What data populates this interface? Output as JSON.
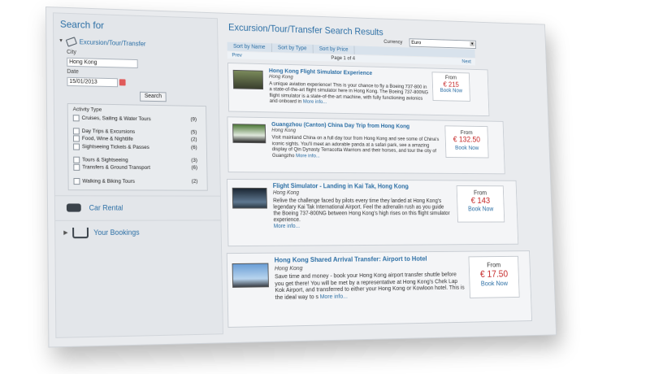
{
  "sidebar": {
    "title": "Search for",
    "tab_label": "Excursion/Tour/Transfer",
    "city_label": "City",
    "city_value": "Hong Kong",
    "date_label": "Date",
    "date_value": "15/01/2013",
    "search_button": "Search",
    "activity_title": "Activity Type",
    "activities": [
      {
        "label": "Cruises, Sailing & Water Tours",
        "count": "(9)"
      },
      {
        "label": "Day Trips & Excursions",
        "count": "(5)"
      },
      {
        "label": "Food, Wine & Nightlife",
        "count": "(2)"
      },
      {
        "label": "Sightseeing Tickets & Passes",
        "count": "(6)"
      },
      {
        "label": "Tours & Sightseeing",
        "count": "(3)"
      },
      {
        "label": "Transfers & Ground Transport",
        "count": "(6)"
      },
      {
        "label": "Walking & Biking Tours",
        "count": "(2)"
      }
    ],
    "car_rental": "Car Rental",
    "your_bookings": "Your Bookings"
  },
  "results": {
    "title": "Excursion/Tour/Transfer Search Results",
    "currency_label": "Currency",
    "currency_value": "Euro",
    "sort": [
      "Sort by Name",
      "Sort by Type",
      "Sort by Price"
    ],
    "pager": {
      "prev": "Prev",
      "page": "Page 1 of 4",
      "next": "Next"
    },
    "items": [
      {
        "title": "Hong Kong Flight Simulator Experience",
        "city": "Hong Kong",
        "desc": "A unique aviation experience! This is your chance to fly a Boeing 737-800 in a state-of-the-art flight simulator here in Hong Kong. The Boeing 737-800NG flight simulator is a state-of-the-art machine, with fully functioning avionics and onboard in",
        "more": "More info...",
        "from": "From",
        "price": "€ 215",
        "book": "Book Now"
      },
      {
        "title": "Guangzhou (Canton) China Day Trip from Hong Kong",
        "city": "Hong Kong",
        "desc": "Visit mainland China on a full day tour from Hong Kong and see some of China's iconic sights. You'll meet an adorable panda at a safari park, see a amazing display of Qin Dynasty Terracotta Warriors and their horses, and tour the city of Guangzho",
        "more": "More info...",
        "from": "From",
        "price": "€ 132.50",
        "book": "Book Now"
      },
      {
        "title": "Flight Simulator - Landing in Kai Tak, Hong Kong",
        "city": "Hong Kong",
        "desc": "Relive the challenge faced by pilots every time they landed at Hong Kong's legendary Kai Tak International Airport. Feel the adrenalin rush as you guide the Boeing 737-800NG between Hong Kong's high rises on this flight simulator experience.",
        "more": "More info...",
        "from": "From",
        "price": "€ 143",
        "book": "Book Now"
      },
      {
        "title": "Hong Kong Shared Arrival Transfer: Airport to Hotel",
        "city": "Hong Kong",
        "desc": "Save time and money - book your Hong Kong airport transfer shuttle before you get there! You will be met by a representative at Hong Kong's Chek Lap Kok Airport, and transferred to either your Hong Kong or Kowloon hotel. This is the ideal way to s",
        "more": "More info...",
        "from": "From",
        "price": "€ 17.50",
        "book": "Book Now"
      }
    ]
  }
}
